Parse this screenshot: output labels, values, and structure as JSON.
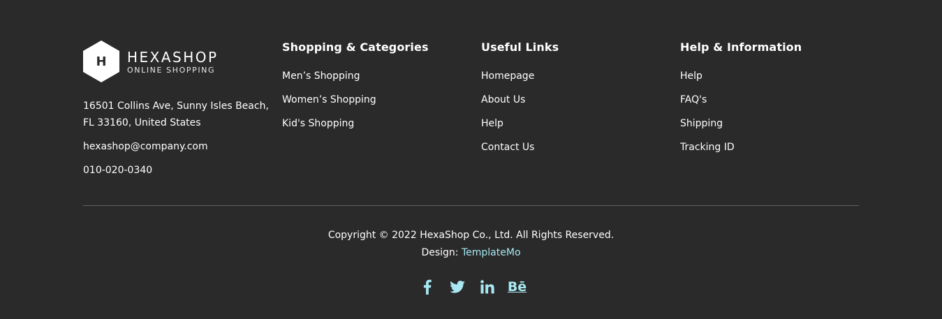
{
  "brand": {
    "logo_letter": "H",
    "name": "HEXASHOP",
    "tagline": "ONLINE SHOPPING",
    "address_line1": "16501 Collins Ave, Sunny Isles Beach,",
    "address_line2": "FL 33160, United States",
    "email": "hexashop@company.com",
    "phone": "010-020-0340"
  },
  "columns": [
    {
      "title": "Shopping & Categories",
      "links": [
        "Men’s Shopping",
        "Women’s Shopping",
        "Kid's Shopping"
      ]
    },
    {
      "title": "Useful Links",
      "links": [
        "Homepage",
        "About Us",
        "Help",
        "Contact Us"
      ]
    },
    {
      "title": "Help & Information",
      "links": [
        "Help",
        "FAQ's",
        "Shipping",
        "Tracking ID"
      ]
    }
  ],
  "bottom": {
    "copyright": "Copyright © 2022 HexaShop Co., Ltd. All Rights Reserved.",
    "design_prefix": "Design: ",
    "design_link": "TemplateMo"
  },
  "social": {
    "icons": [
      "facebook-icon",
      "twitter-icon",
      "linkedin-icon",
      "behance-icon"
    ],
    "behance_text": "Bē"
  },
  "colors": {
    "background": "#2a2a2a",
    "text": "#ffffff",
    "accent": "#a8e8f2",
    "divider": "#5e5e5e"
  }
}
